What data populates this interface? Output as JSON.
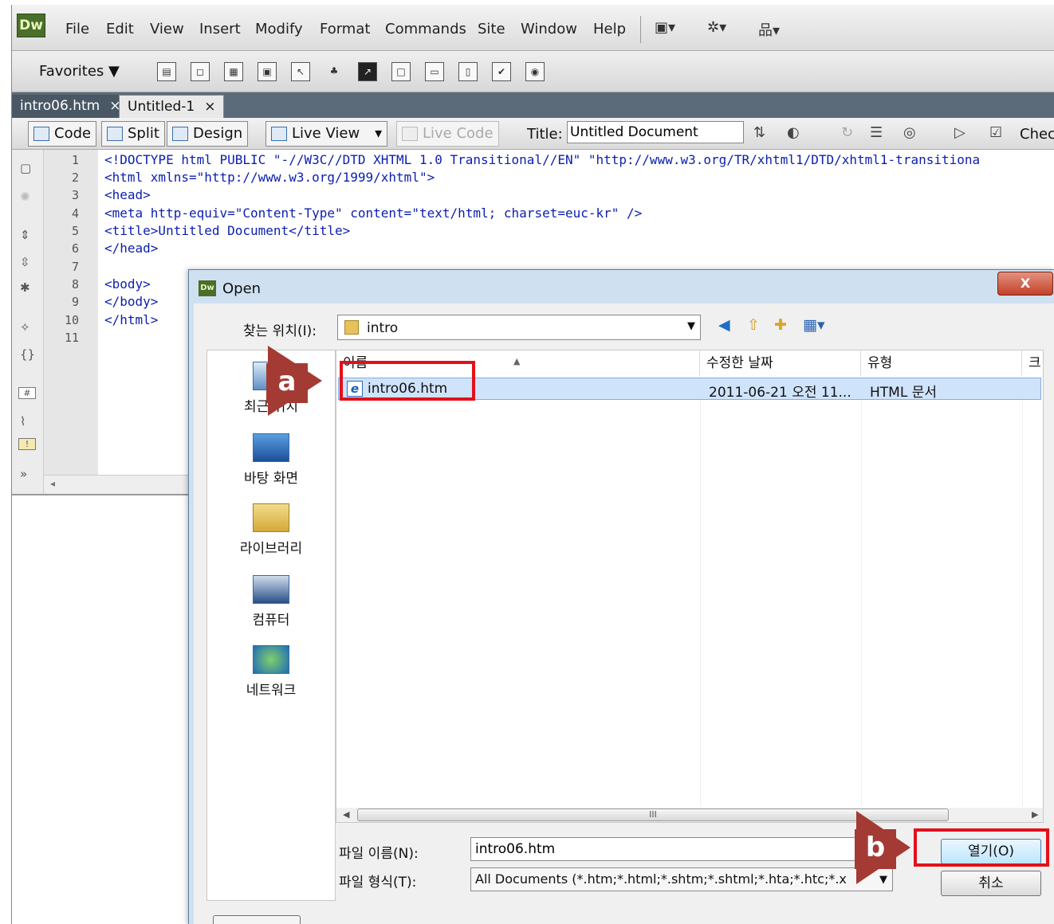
{
  "app": {
    "logo": "Dw",
    "menu": [
      "File",
      "Edit",
      "View",
      "Insert",
      "Modify",
      "Format",
      "Commands",
      "Site",
      "Window",
      "Help"
    ],
    "menubar_icons": [
      "layout-icon",
      "gear-icon",
      "site-icon"
    ]
  },
  "insert_bar": {
    "category": "Favorites",
    "category_arrow": "▼"
  },
  "document_tabs": [
    {
      "label": "intro06.htm",
      "close": "×"
    },
    {
      "label": "Untitled-1",
      "close": "×"
    }
  ],
  "doc_toolbar": {
    "code": "Code",
    "split": "Split",
    "design": "Design",
    "live_view": "Live View",
    "live_code": "Live Code",
    "title_label": "Title:",
    "title_value": "Untitled Document",
    "check": "Chec"
  },
  "code": {
    "line_numbers": [
      "1",
      "2",
      "3",
      "4",
      "5",
      "6",
      "7",
      "8",
      "9",
      "10",
      "11"
    ],
    "lines": [
      "<!DOCTYPE html PUBLIC \"-//W3C//DTD XHTML 1.0 Transitional//EN\" \"http://www.w3.org/TR/xhtml1/DTD/xhtml1-transitiona",
      "<html xmlns=\"http://www.w3.org/1999/xhtml\">",
      "<head>",
      "<meta http-equiv=\"Content-Type\" content=\"text/html; charset=euc-kr\" />",
      "<title>Untitled Document</title>",
      "</head>",
      "",
      "<body>",
      "</body>",
      "</html>",
      ""
    ]
  },
  "dialog": {
    "title": "Open",
    "close": "X",
    "look_in_label": "찾는 위치(I):",
    "look_in_value": "intro",
    "places": [
      "최근 위치",
      "바탕 화면",
      "라이브러리",
      "컴퓨터",
      "네트워크"
    ],
    "columns": [
      "이름",
      "수정한 날짜",
      "유형",
      "크"
    ],
    "files": [
      {
        "name": "intro06.htm",
        "modified": "2011-06-21 오전 11...",
        "type": "HTML 문서"
      }
    ],
    "file_name_label": "파일 이름(N):",
    "file_name_value": "intro06.htm",
    "file_type_label": "파일 형식(T):",
    "file_type_value": "All Documents (*.htm;*.html;*.shtm;*.shtml;*.hta;*.htc;*.x",
    "open_button": "열기(O)",
    "cancel_button": "취소",
    "scroll_grip": "III"
  },
  "annotations": {
    "a": "a",
    "b": "b",
    "color": "#e3101a",
    "letter_bg": "#a43a34"
  }
}
